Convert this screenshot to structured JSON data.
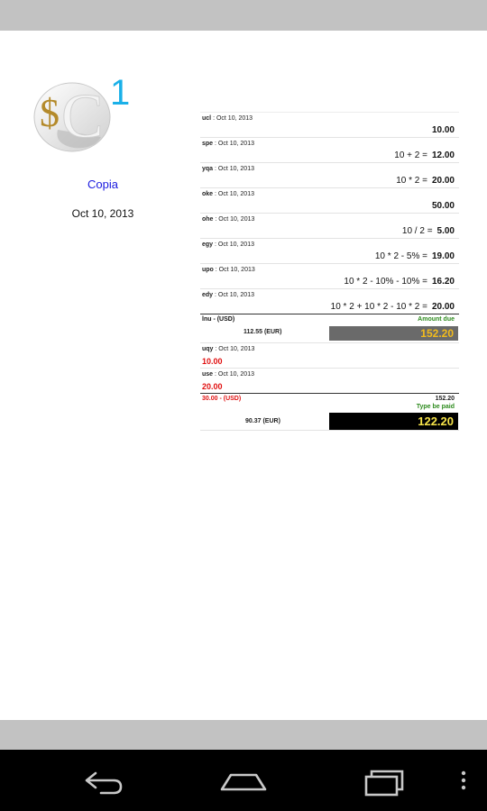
{
  "app": {
    "logo_text": "$C1",
    "copy_label": "Copia",
    "date": "Oct 10, 2013"
  },
  "lines": [
    {
      "code": "ucl",
      "date": "Oct 10, 2013",
      "expr": "",
      "amount": "10.00"
    },
    {
      "code": "spe",
      "date": "Oct 10, 2013",
      "expr": "10 + 2 =",
      "amount": "12.00"
    },
    {
      "code": "yqa",
      "date": "Oct 10, 2013",
      "expr": "10 * 2 =",
      "amount": "20.00"
    },
    {
      "code": "oke",
      "date": "Oct 10, 2013",
      "expr": "",
      "amount": "50.00"
    },
    {
      "code": "ohe",
      "date": "Oct 10, 2013",
      "expr": "10 / 2 =",
      "amount": "5.00"
    },
    {
      "code": "egy",
      "date": "Oct 10, 2013",
      "expr": "10 * 2 - 5% =",
      "amount": "19.00"
    },
    {
      "code": "upo",
      "date": "Oct 10, 2013",
      "expr": "10 * 2 - 10% - 10% =",
      "amount": "16.20"
    },
    {
      "code": "edy",
      "date": "Oct 10, 2013",
      "expr": "10 * 2 + 10 * 2 - 10 * 2 =",
      "amount": "20.00"
    }
  ],
  "total": {
    "title": "lnu - (USD)",
    "eur": "112.55 (EUR)",
    "amount_due_label": "Amount due",
    "amount_due": "152.20"
  },
  "payments": [
    {
      "code": "uqy",
      "date": "Oct 10, 2013",
      "amount": "10.00"
    },
    {
      "code": "use",
      "date": "Oct 10, 2013",
      "amount": "20.00"
    }
  ],
  "final": {
    "paid_usd": "30.00 - (USD)",
    "due_usd": "152.20",
    "to_be_paid_label": "Type be paid",
    "eur_remaining": "90.37 (EUR)",
    "to_be_paid": "122.20"
  },
  "nav": {
    "back_icon": "back-arrow-icon",
    "home_icon": "home-icon",
    "recents_icon": "recent-apps-icon",
    "menu_icon": "overflow-menu-icon"
  },
  "colors": {
    "status_bar": "#c2c2c2",
    "copy_label": "#1a1adf",
    "amount_due_label": "#2e8b1e",
    "amount_due_box": "#6a6a6a",
    "amount_due_value": "#f2bb1c",
    "payment_value": "#e01010",
    "to_be_paid_box": "#000000",
    "to_be_paid_value": "#f7e44a",
    "logo_accent": "#1ab0e8"
  }
}
